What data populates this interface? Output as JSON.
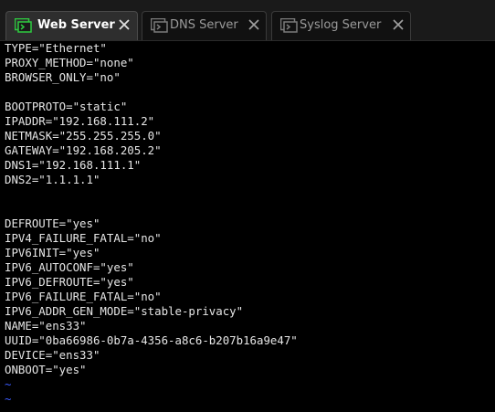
{
  "tabs": [
    {
      "label": "Web Server",
      "active": true
    },
    {
      "label": "DNS Server",
      "active": false
    },
    {
      "label": "Syslog Server",
      "active": false
    }
  ],
  "colors": {
    "icon_green": "#2ecc40",
    "tilde_blue": "#3b5bff",
    "terminal_text": "#e6e6e6"
  },
  "terminal": {
    "lines": [
      "TYPE=\"Ethernet\"",
      "PROXY_METHOD=\"none\"",
      "BROWSER_ONLY=\"no\"",
      "",
      "BOOTPROTO=\"static\"",
      "IPADDR=\"192.168.111.2\"",
      "NETMASK=\"255.255.255.0\"",
      "GATEWAY=\"192.168.205.2\"",
      "DNS1=\"192.168.111.1\"",
      "DNS2=\"1.1.1.1\"",
      "",
      "",
      "DEFROUTE=\"yes\"",
      "IPV4_FAILURE_FATAL=\"no\"",
      "IPV6INIT=\"yes\"",
      "IPV6_AUTOCONF=\"yes\"",
      "IPV6_DEFROUTE=\"yes\"",
      "IPV6_FAILURE_FATAL=\"no\"",
      "IPV6_ADDR_GEN_MODE=\"stable-privacy\"",
      "NAME=\"ens33\"",
      "UUID=\"0ba66986-0b7a-4356-a8c6-b207b16a9e47\"",
      "DEVICE=\"ens33\"",
      "ONBOOT=\"yes\"",
      "~",
      "~"
    ]
  }
}
